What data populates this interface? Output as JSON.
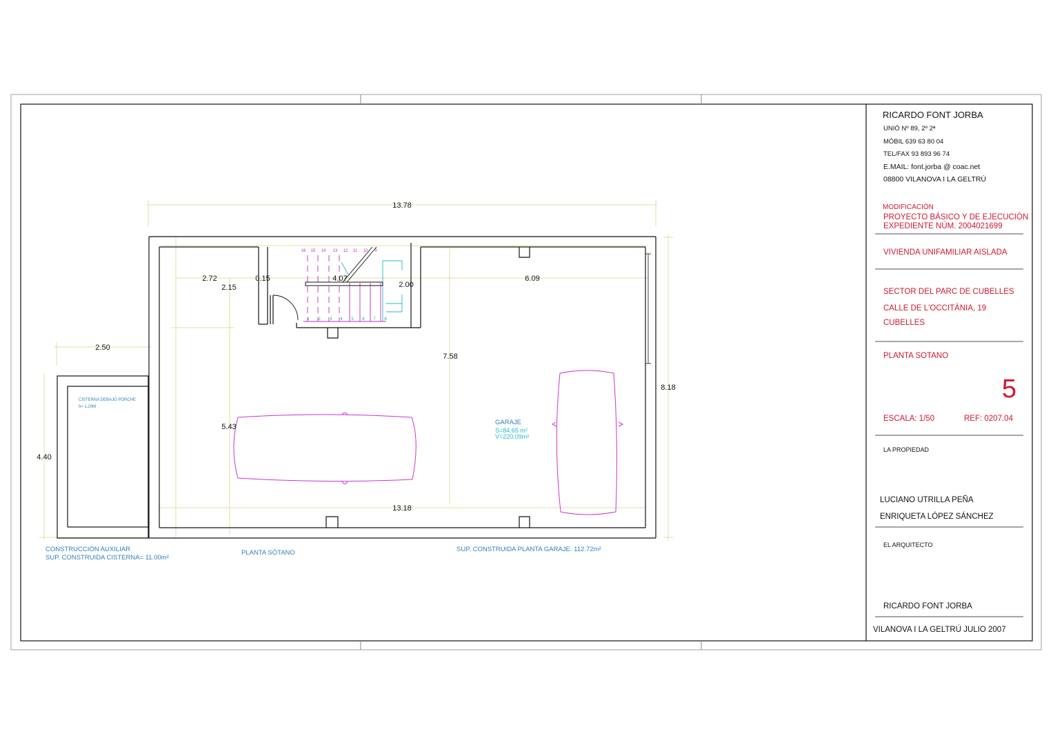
{
  "dimensions": {
    "top_overall": "13.78",
    "bottom_inner": "13.18",
    "right_overall": "8.18",
    "center_vertical": "7.58",
    "left_vertical": "5.43",
    "stair_left_width": "2.72",
    "stair_gap": "0.15",
    "stair_width": "4.07",
    "stair_depth": "2.00",
    "right_span": "6.09",
    "stair_height": "2.15",
    "aux_width": "2.50",
    "aux_height": "4.40"
  },
  "cistern": {
    "label": "CISTERNA DEBAJO PORCHE",
    "height": "h= 1,20M"
  },
  "garage": {
    "name": "GARAJE",
    "surface": "S=84.65 m²",
    "volume": "V=220.09m²"
  },
  "stair_numbers_top": [
    "16",
    "15",
    "14",
    "13",
    "12",
    "11",
    "10",
    "9"
  ],
  "stair_numbers_bottom": [
    "1",
    "2",
    "3",
    "4",
    "5",
    "6",
    "7",
    "8"
  ],
  "captions": {
    "aux_title": "CONSTRUCCIÓN AUXILIAR",
    "aux_surface": "SUP. CONSTRUIDA CISTERNA= 11.00m²",
    "plan_title": "PLANTA SÓTANO",
    "garage_surface": "SUP. CONSTRUIDA PLANTA GARAJE. 112.72m²"
  },
  "title_block": {
    "architect_name": "RICARDO  FONT  JORBA",
    "address": "UNIÓ Nº 89,   2º 2ª",
    "mobile": "MÒBIL     639 63 80 04",
    "telfax": "TEL/FAX  93 893 96 74",
    "email": "E.MAIL:  font.jorba  @  coac.net",
    "city": "08800 VILANOVA I LA GELTRÚ",
    "modification": "MODIFICACIÓN",
    "project": "PROYECTO BÁSICO Y DE EJECUCIÓN",
    "file": "EXPEDIENTE NÚM. 2004021699",
    "building": "VIVIENDA UNIFAMILIAR AISLADA",
    "sector": "SECTOR DEL PARC DE CUBELLES",
    "street": "CALLE DE L'OCCITÀNIA, 19",
    "town": "CUBELLES",
    "plan": "PLANTA SOTANO",
    "sheet_number": "5",
    "scale": "ESCALA:  1/50",
    "ref": "REF:  0207.04",
    "owner_label": "LA PROPIEDAD",
    "owner_1": "LUCIANO UTRILLA PEÑA",
    "owner_2": "ENRIQUETA LÓPEZ SÁNCHEZ",
    "architect_label": "EL ARQUITECTO",
    "architect_signature": "RICARDO FONT JORBA",
    "place_date": "VILANOVA I LA GELTRÚ    JULIO 2007"
  },
  "colors": {
    "wall": "#111111",
    "dimension_line": "#e3dca6",
    "vehicle": "#cc33cc",
    "stair_cyan": "#25b8c9",
    "title_red": "#d1172f",
    "caption_blue": "#2f7fb8"
  }
}
